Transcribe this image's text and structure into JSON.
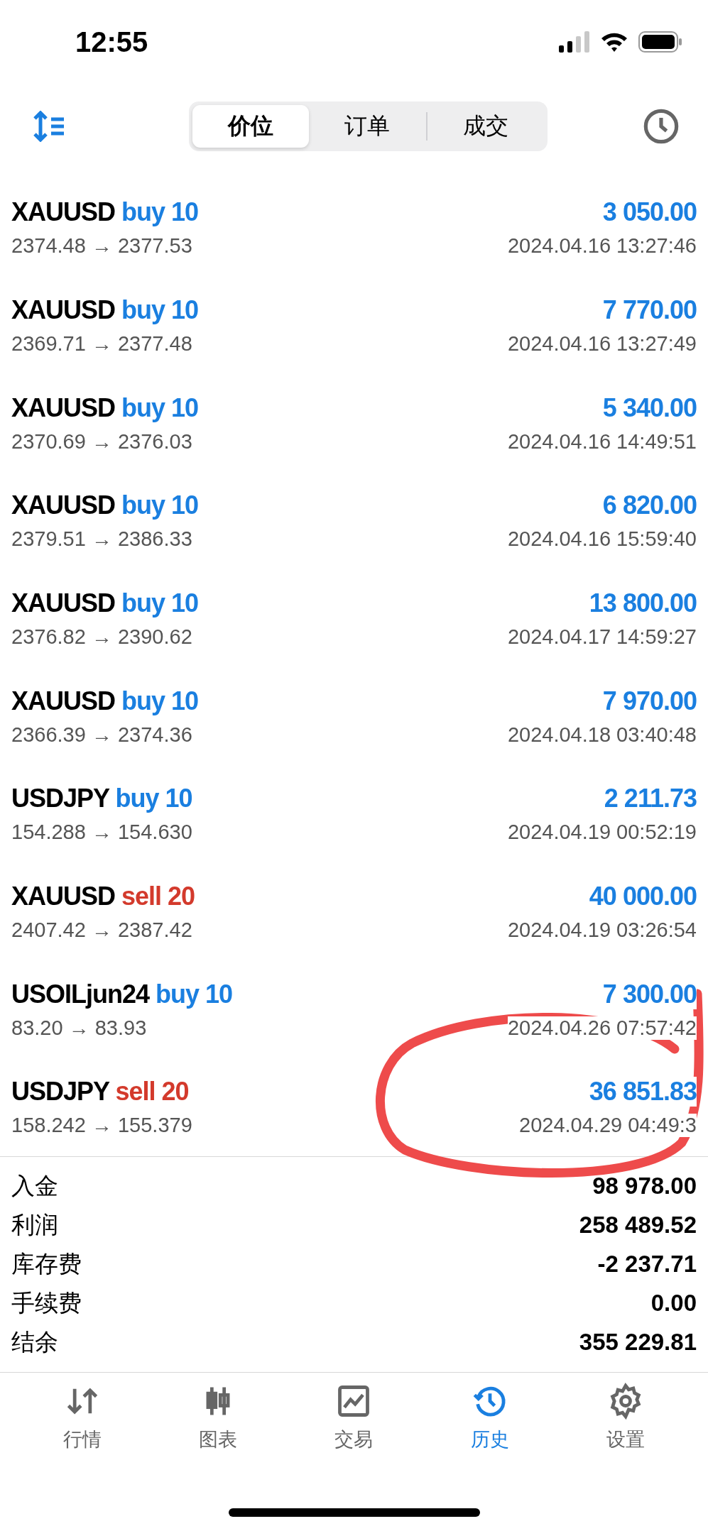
{
  "status_bar": {
    "time": "12:55"
  },
  "tabs": [
    {
      "label": "价位",
      "selected": true
    },
    {
      "label": "订单",
      "selected": false
    },
    {
      "label": "成交",
      "selected": false
    }
  ],
  "deals": [
    {
      "symbol": "XAUUSD",
      "kind": "buy",
      "action": "buy 10",
      "prices": "2374.48 → 2377.53",
      "profit": "3 050.00",
      "time": "2024.04.16 13:27:46"
    },
    {
      "symbol": "XAUUSD",
      "kind": "buy",
      "action": "buy 10",
      "prices": "2369.71 → 2377.48",
      "profit": "7 770.00",
      "time": "2024.04.16 13:27:49"
    },
    {
      "symbol": "XAUUSD",
      "kind": "buy",
      "action": "buy 10",
      "prices": "2370.69 → 2376.03",
      "profit": "5 340.00",
      "time": "2024.04.16 14:49:51"
    },
    {
      "symbol": "XAUUSD",
      "kind": "buy",
      "action": "buy 10",
      "prices": "2379.51 → 2386.33",
      "profit": "6 820.00",
      "time": "2024.04.16 15:59:40"
    },
    {
      "symbol": "XAUUSD",
      "kind": "buy",
      "action": "buy 10",
      "prices": "2376.82 → 2390.62",
      "profit": "13 800.00",
      "time": "2024.04.17 14:59:27"
    },
    {
      "symbol": "XAUUSD",
      "kind": "buy",
      "action": "buy 10",
      "prices": "2366.39 → 2374.36",
      "profit": "7 970.00",
      "time": "2024.04.18 03:40:48"
    },
    {
      "symbol": "USDJPY",
      "kind": "buy",
      "action": "buy 10",
      "prices": "154.288 → 154.630",
      "profit": "2 211.73",
      "time": "2024.04.19 00:52:19"
    },
    {
      "symbol": "XAUUSD",
      "kind": "sell",
      "action": "sell 20",
      "prices": "2407.42 → 2387.42",
      "profit": "40 000.00",
      "time": "2024.04.19 03:26:54"
    },
    {
      "symbol": "USOILjun24",
      "kind": "buy",
      "action": "buy 10",
      "prices": "83.20 → 83.93",
      "profit": "7 300.00",
      "time": "2024.04.26 07:57:42"
    },
    {
      "symbol": "USDJPY",
      "kind": "sell",
      "action": "sell 20",
      "prices": "158.242 → 155.379",
      "profit": "36 851.83",
      "time": "2024.04.29 04:49:3"
    }
  ],
  "summary": [
    {
      "label": "入金",
      "value": "98 978.00"
    },
    {
      "label": "利润",
      "value": "258 489.52"
    },
    {
      "label": "库存费",
      "value": "-2 237.71"
    },
    {
      "label": "手续费",
      "value": "0.00"
    },
    {
      "label": "结余",
      "value": "355 229.81"
    }
  ],
  "nav": [
    {
      "label": "行情",
      "kind": "quotes",
      "selected": false
    },
    {
      "label": "图表",
      "kind": "chart",
      "selected": false
    },
    {
      "label": "交易",
      "kind": "trade",
      "selected": false
    },
    {
      "label": "历史",
      "kind": "history",
      "selected": true
    },
    {
      "label": "设置",
      "kind": "settings",
      "selected": false
    }
  ]
}
